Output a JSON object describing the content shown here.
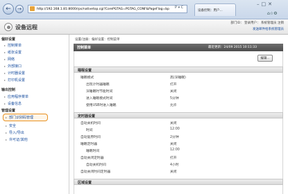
{
  "browser": {
    "url": "http://192.168.1.81:8000/rps/nativetop.cgi?CorePGTAG=PGTAG_CONF&PageFlag=bp",
    "tab_title": "设备控制：用户...",
    "search_glyph": "P ▾ C"
  },
  "app": {
    "title": "设备远程",
    "top_links": "部门ID：   登录用户：   系统管理员   注销",
    "top_links2": "发送邮件给系统管理员"
  },
  "breadcrumb": "设置/注册：偏好设置：控制菜单",
  "sidebar": {
    "sections": [
      {
        "label": "偏好设置",
        "items": [
          "控制菜单",
          "纸张设置",
          "网络",
          "外部接口",
          "计时器设置",
          "打印机设置"
        ]
      },
      {
        "label": "输出控制",
        "items": [
          "应用程序菜单",
          "设备信息"
        ]
      },
      {
        "label": "管理设置",
        "items": [
          "部门识别码管理",
          "安全",
          "导入/导出",
          "许可证/其他"
        ]
      }
    ]
  },
  "main": {
    "header": "控制菜单",
    "last_updated": "最近更新：24/09 2015 10:11:33",
    "edit_button": "编辑...",
    "sections": [
      {
        "title": "睡眠设置",
        "rows": [
          {
            "label": "睡眠模式",
            "value": "高(深睡眠)"
          },
          {
            "label": "出现计时器睡眠",
            "value": "打开"
          },
          {
            "label": "深睡眠时节能时间",
            "value": "关闭"
          },
          {
            "label": "进入睡眠模式时间",
            "value": "5分钟"
          },
          {
            "label": "使用USB时进入睡眠",
            "value": "允许"
          }
        ]
      },
      {
        "title": "定时器设置",
        "rows": [
          {
            "label": "自动关机时间",
            "value": "关闭"
          },
          {
            "label": "时间",
            "value": "12:00"
          },
          {
            "label": "自动复原时间",
            "value": "2分钟"
          },
          {
            "label": "睡眠定时器",
            "value": "关闭"
          },
          {
            "label": "睡眠时间",
            "value": "12:00"
          },
          {
            "label": "自动关闭定时器",
            "value": "打开"
          },
          {
            "label": "自动关机时间",
            "value": "4小时"
          },
          {
            "label": "自动关闭时间定时器",
            "value": "关闭"
          }
        ]
      },
      {
        "title": "区域设置",
        "rows": []
      }
    ]
  }
}
